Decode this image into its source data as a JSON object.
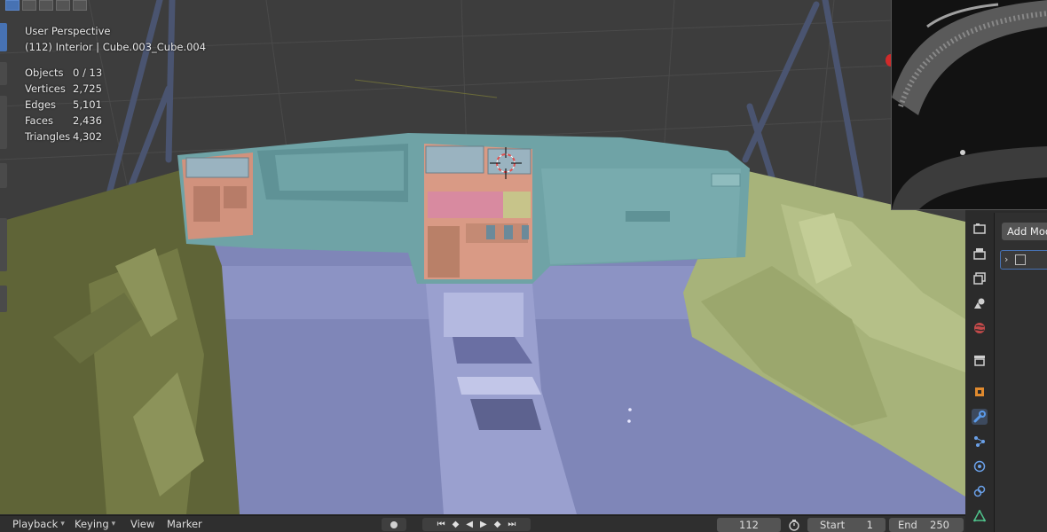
{
  "viewport": {
    "perspective_label": "User Perspective",
    "object_label": "(112) Interior | Cube.003_Cube.004",
    "stats": [
      {
        "key": "Objects",
        "value": "0 / 13"
      },
      {
        "key": "Vertices",
        "value": "2,725"
      },
      {
        "key": "Edges",
        "value": "5,101"
      },
      {
        "key": "Faces",
        "value": "2,436"
      },
      {
        "key": "Triangles",
        "value": "4,302"
      }
    ]
  },
  "properties": {
    "add_modifier_label": "Add Modifier",
    "tabs": [
      "render-icon",
      "output-icon",
      "view-layer-icon",
      "scene-icon",
      "world-icon",
      "collection-icon",
      "object-icon",
      "modifier-wrench-icon",
      "particles-icon",
      "physics-icon",
      "constraints-icon",
      "object-data-icon"
    ],
    "active_tab": "modifier-wrench-icon"
  },
  "timeline": {
    "menus": [
      "Playback",
      "Keying",
      "View",
      "Marker"
    ],
    "current_frame": "112",
    "start_label": "Start",
    "start_value": "1",
    "end_label": "End",
    "end_value": "250"
  },
  "colors": {
    "dashboard": "#6fa3a6",
    "floor": "#7f86b8",
    "door_panels": "#a7b37a",
    "accent": "#4772b3"
  }
}
